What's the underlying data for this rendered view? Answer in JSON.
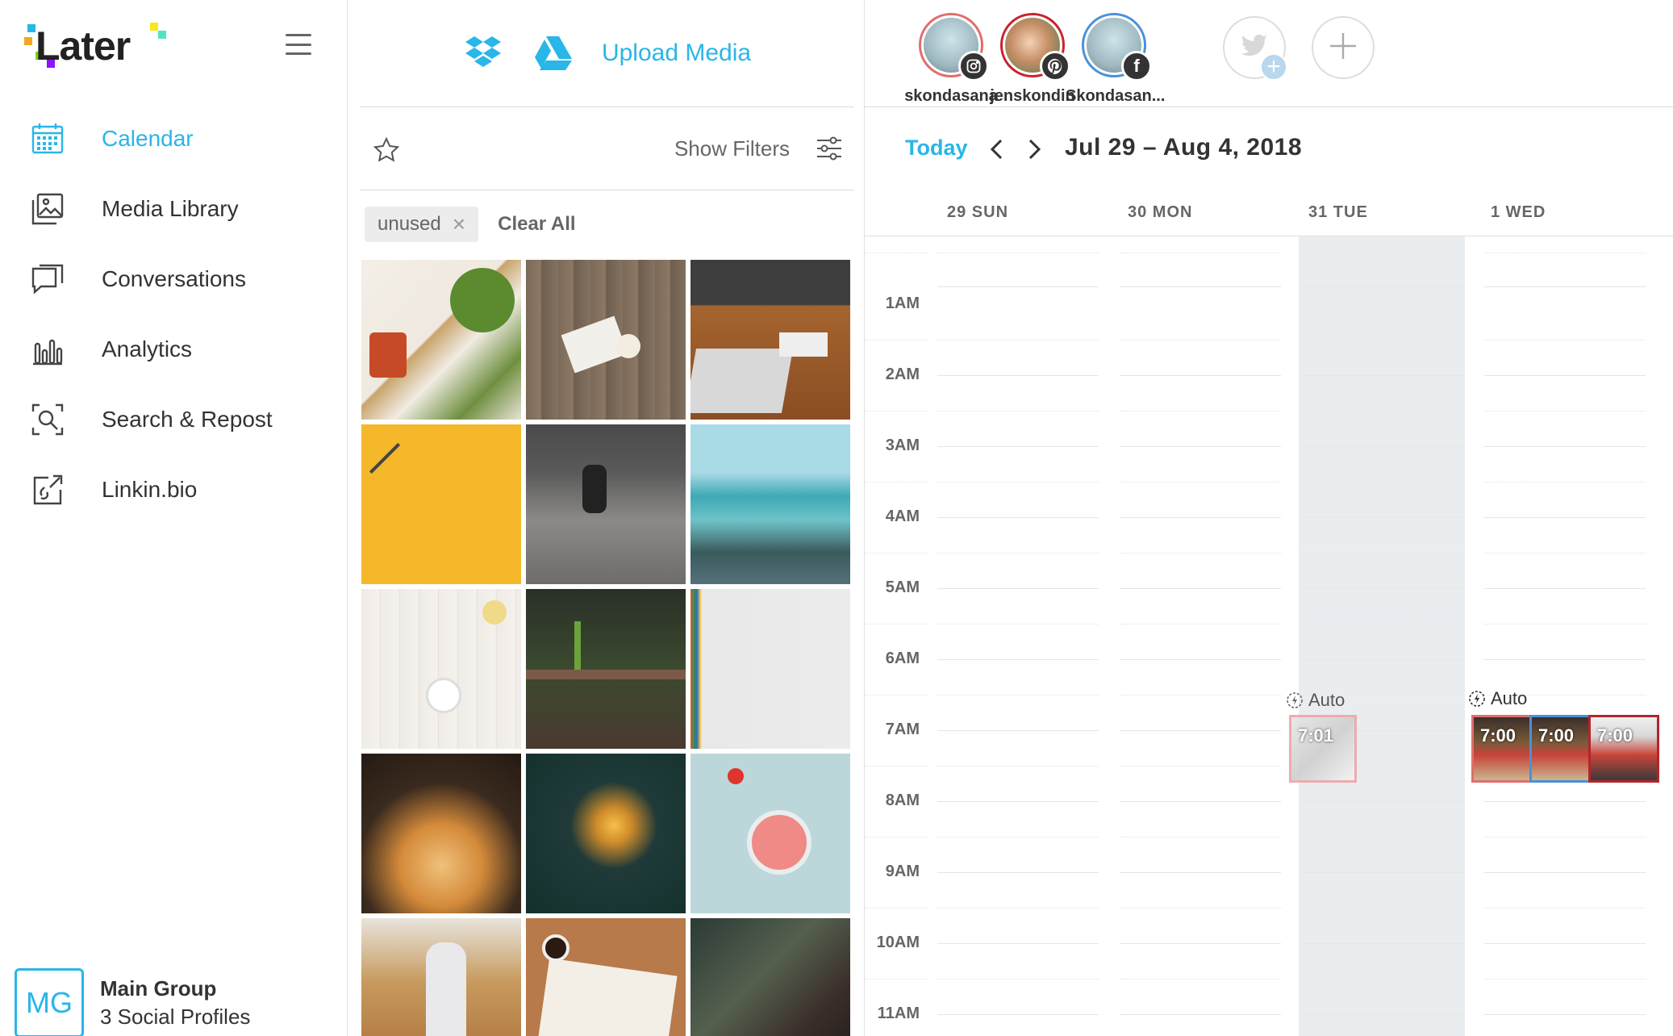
{
  "brand": {
    "logo_text": "Later",
    "accent": "#29b6e8"
  },
  "sidebar": {
    "items": [
      {
        "label": "Calendar",
        "icon": "calendar-icon",
        "active": true
      },
      {
        "label": "Media Library",
        "icon": "media-library-icon"
      },
      {
        "label": "Conversations",
        "icon": "conversations-icon"
      },
      {
        "label": "Analytics",
        "icon": "analytics-icon"
      },
      {
        "label": "Search & Repost",
        "icon": "search-repost-icon"
      },
      {
        "label": "Linkin.bio",
        "icon": "linkin-bio-icon"
      }
    ],
    "group": {
      "initials": "MG",
      "name": "Main Group",
      "profiles": "3 Social Profiles"
    }
  },
  "media": {
    "upload_label": "Upload Media",
    "show_filters": "Show Filters",
    "tag": "unused",
    "tag_remove": "×",
    "clear_all": "Clear All"
  },
  "profiles": [
    {
      "name": "skondasana",
      "network": "instagram",
      "ring": "#e26d6d"
    },
    {
      "name": "jenskondin",
      "network": "pinterest",
      "ring": "#c8232c"
    },
    {
      "name": "Skondasan...",
      "network": "facebook",
      "ring": "#4a90d9"
    }
  ],
  "calendar": {
    "today": "Today",
    "range": "Jul 29 – Aug 4, 2018",
    "days": [
      "29 SUN",
      "30 MON",
      "31 TUE",
      "1 WED"
    ],
    "hours": [
      "1AM",
      "2AM",
      "3AM",
      "4AM",
      "5AM",
      "6AM",
      "7AM",
      "8AM",
      "9AM",
      "10AM",
      "11AM"
    ],
    "auto_label": "Auto",
    "posts": {
      "tue": "7:01",
      "wed": [
        "7:00",
        "7:00",
        "7:00"
      ]
    }
  }
}
